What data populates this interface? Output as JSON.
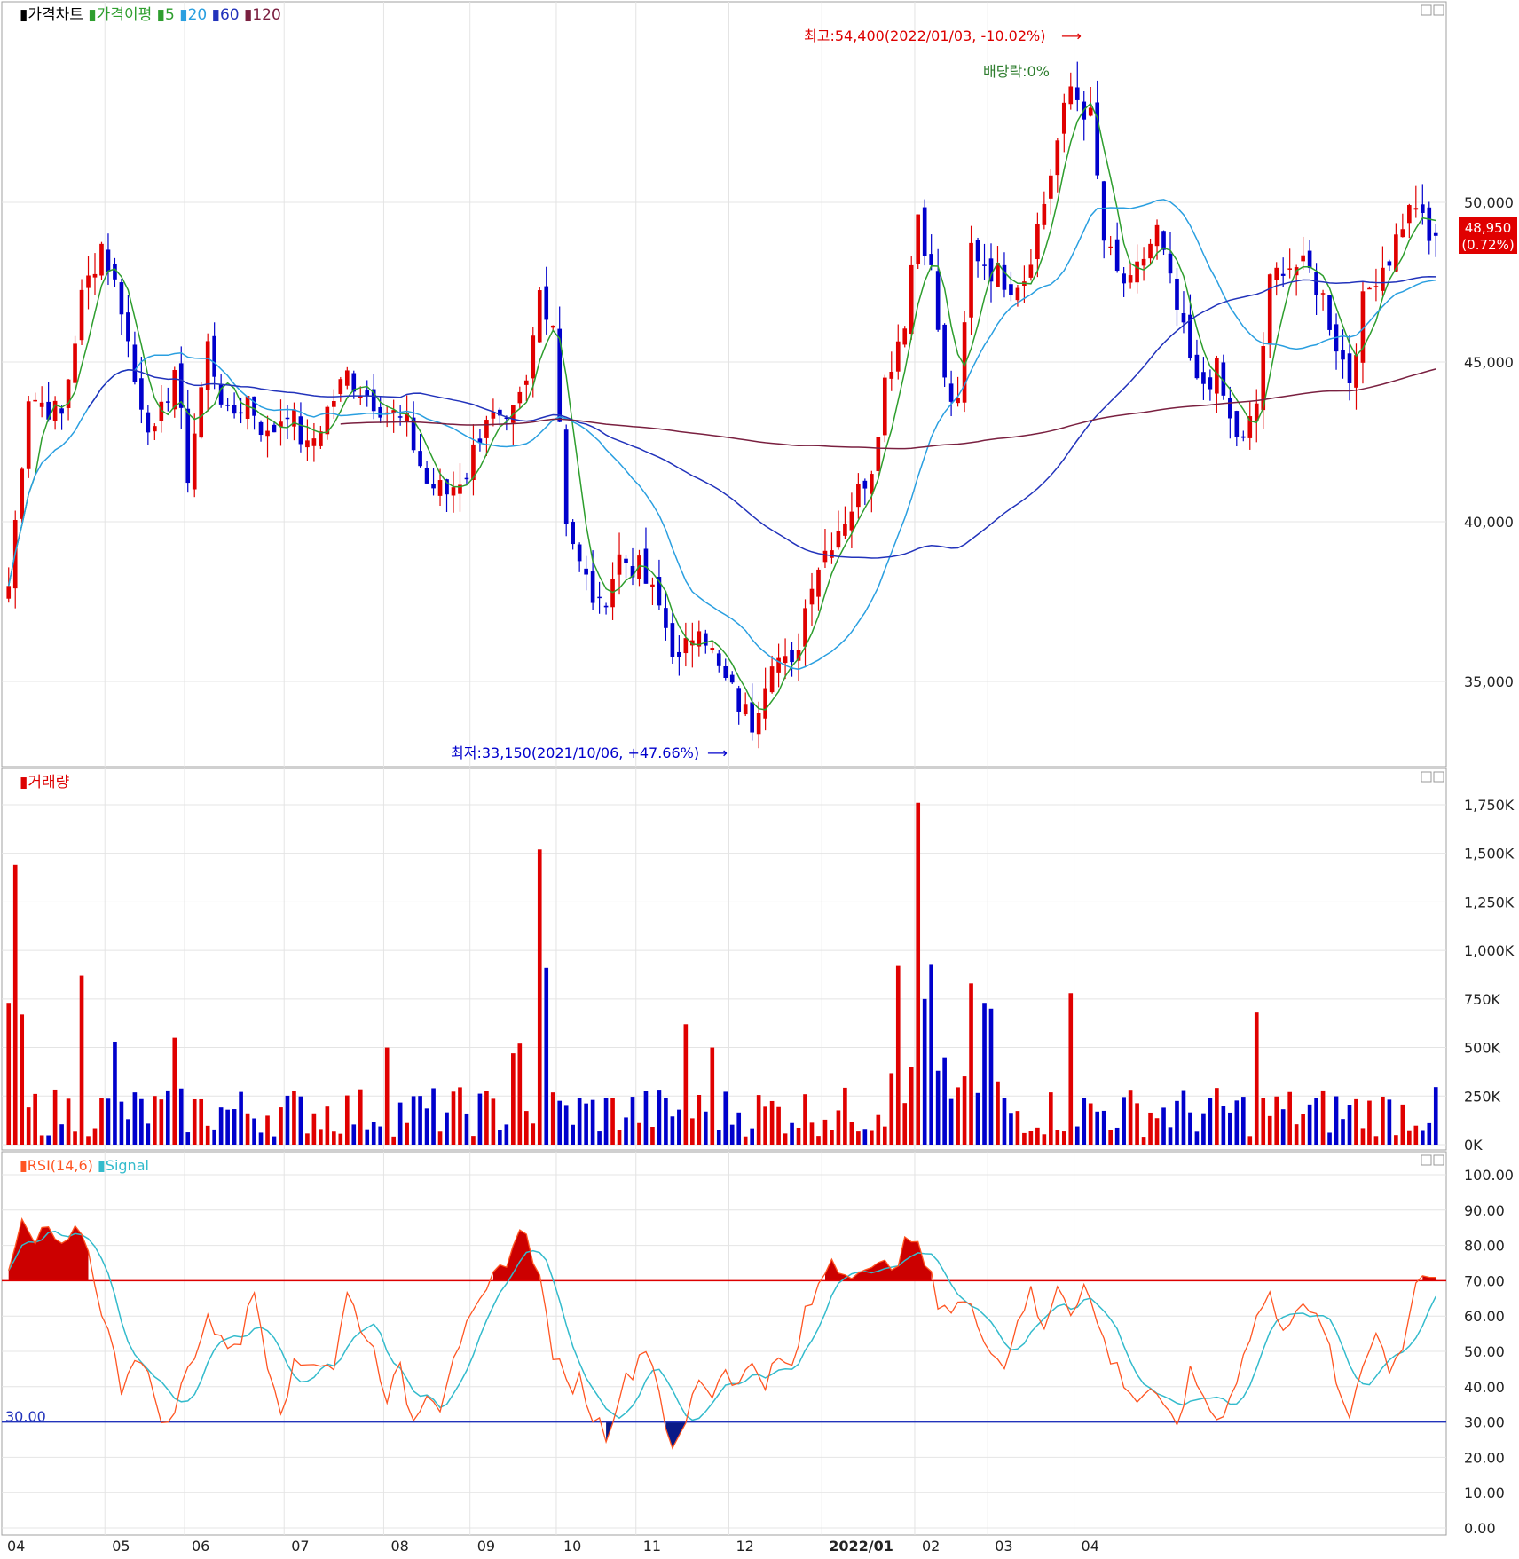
{
  "legends": {
    "price": [
      {
        "text": "가격차트",
        "color": "#000000"
      },
      {
        "text": "가격이평",
        "color": "#2e9e2e"
      },
      {
        "text": "5",
        "color": "#2e9e2e"
      },
      {
        "text": "20",
        "color": "#2a9fe0"
      },
      {
        "text": "60",
        "color": "#2233bb"
      },
      {
        "text": "120",
        "color": "#7a2040"
      }
    ],
    "volume": [
      {
        "text": "거래량",
        "color": "#dd0000"
      }
    ],
    "rsi": [
      {
        "text": "RSI(14,6)",
        "color": "#ff5522"
      },
      {
        "text": "Signal",
        "color": "#33bbcc"
      }
    ]
  },
  "annotations": {
    "high": "최고:54,400(2022/01/03, -10.02%)",
    "low": "최저:33,150(2021/10/06, +47.66%)",
    "dividend": "배당락:0%"
  },
  "current_price": {
    "price": "48,950",
    "change": "(0.72%)"
  },
  "rsi_level_label": "30.00",
  "x_ticks": [
    "04",
    "05",
    "06",
    "07",
    "08",
    "09",
    "10",
    "11",
    "12",
    "2022/01",
    "02",
    "03",
    "04"
  ],
  "price_ticks": [
    "50,000",
    "45,000",
    "40,000",
    "35,000"
  ],
  "volume_ticks": [
    "1,750K",
    "1,500K",
    "1,250K",
    "1,000K",
    "750K",
    "500K",
    "250K",
    "0K"
  ],
  "rsi_ticks": [
    "100.00",
    "90.00",
    "80.00",
    "70.00",
    "60.00",
    "50.00",
    "40.00",
    "30.00",
    "20.00",
    "10.00",
    "0.00"
  ],
  "colors": {
    "up": "#e00000",
    "down": "#0000cc",
    "ma5": "#2e9e2e",
    "ma20": "#2a9fe0",
    "ma60": "#2233bb",
    "ma120": "#7a2040",
    "rsi": "#ff5522",
    "signal": "#33bbcc",
    "grid": "#e4e4e4"
  },
  "chart_data": [
    {
      "type": "candlestick",
      "title": "가격차트",
      "x_months": [
        "04",
        "05",
        "06",
        "07",
        "08",
        "09",
        "10",
        "11",
        "12",
        "2022/01",
        "02",
        "03",
        "04"
      ],
      "ylim": [
        32500,
        55500
      ],
      "high": {
        "value": 54400,
        "date": "2022/01/03"
      },
      "low": {
        "value": 33150,
        "date": "2021/10/06"
      },
      "last": 48950,
      "anchors": [
        [
          0,
          38000
        ],
        [
          3,
          44000
        ],
        [
          8,
          43300
        ],
        [
          11,
          47000
        ],
        [
          14,
          48700
        ],
        [
          17,
          46800
        ],
        [
          19,
          44400
        ],
        [
          22,
          42600
        ],
        [
          25,
          44800
        ],
        [
          27,
          41500
        ],
        [
          30,
          45500
        ],
        [
          33,
          43200
        ],
        [
          36,
          43900
        ],
        [
          39,
          42600
        ],
        [
          42,
          43600
        ],
        [
          45,
          42200
        ],
        [
          48,
          43500
        ],
        [
          51,
          44600
        ],
        [
          54,
          44000
        ],
        [
          57,
          43500
        ],
        [
          60,
          43000
        ],
        [
          63,
          41200
        ],
        [
          66,
          40900
        ],
        [
          69,
          41600
        ],
        [
          72,
          43400
        ],
        [
          75,
          42800
        ],
        [
          78,
          44200
        ],
        [
          80,
          47200
        ],
        [
          82,
          46300
        ],
        [
          84,
          40200
        ],
        [
          86,
          38600
        ],
        [
          89,
          37200
        ],
        [
          92,
          38900
        ],
        [
          95,
          38500
        ],
        [
          98,
          37300
        ],
        [
          101,
          35500
        ],
        [
          104,
          37000
        ],
        [
          107,
          35300
        ],
        [
          110,
          34300
        ],
        [
          112,
          33700
        ],
        [
          115,
          35900
        ],
        [
          118,
          35300
        ],
        [
          121,
          38300
        ],
        [
          124,
          39500
        ],
        [
          127,
          40500
        ],
        [
          130,
          41800
        ],
        [
          132,
          44400
        ],
        [
          135,
          46400
        ],
        [
          137,
          49700
        ],
        [
          139,
          47800
        ],
        [
          141,
          44300
        ],
        [
          143,
          43500
        ],
        [
          145,
          48600
        ],
        [
          148,
          47900
        ],
        [
          151,
          47500
        ],
        [
          153,
          47700
        ],
        [
          156,
          50000
        ],
        [
          158,
          51900
        ],
        [
          160,
          53600
        ],
        [
          163,
          52600
        ],
        [
          165,
          48800
        ],
        [
          167,
          47700
        ],
        [
          169,
          47300
        ],
        [
          171,
          48300
        ],
        [
          173,
          49100
        ],
        [
          175,
          47400
        ],
        [
          177,
          45800
        ],
        [
          179,
          44200
        ],
        [
          182,
          44700
        ],
        [
          184,
          43100
        ],
        [
          186,
          42400
        ],
        [
          188,
          43700
        ],
        [
          190,
          47400
        ],
        [
          192,
          48100
        ],
        [
          194,
          48000
        ],
        [
          196,
          47800
        ],
        [
          198,
          47000
        ],
        [
          200,
          45600
        ],
        [
          202,
          44500
        ],
        [
          204,
          46800
        ],
        [
          206,
          47800
        ],
        [
          208,
          48300
        ],
        [
          210,
          49400
        ],
        [
          212,
          50000
        ],
        [
          213,
          49300
        ],
        [
          214,
          48700
        ],
        [
          215,
          48950
        ]
      ],
      "ma": [
        {
          "name": "5",
          "period": 5
        },
        {
          "name": "20",
          "period": 20
        },
        {
          "name": "60",
          "period": 60
        },
        {
          "name": "120",
          "period": 120
        }
      ]
    },
    {
      "type": "bar",
      "title": "거래량",
      "ylim": [
        0,
        1800
      ],
      "unit": "K",
      "spikes": [
        [
          1,
          1440
        ],
        [
          0,
          730
        ],
        [
          2,
          670
        ],
        [
          11,
          870
        ],
        [
          80,
          1520
        ],
        [
          81,
          910
        ],
        [
          137,
          1760
        ],
        [
          139,
          930
        ],
        [
          138,
          750
        ],
        [
          134,
          920
        ],
        [
          145,
          830
        ],
        [
          147,
          730
        ],
        [
          148,
          700
        ],
        [
          160,
          780
        ],
        [
          188,
          680
        ],
        [
          102,
          620
        ],
        [
          106,
          500
        ],
        [
          57,
          500
        ],
        [
          77,
          520
        ],
        [
          76,
          470
        ],
        [
          16,
          530
        ],
        [
          25,
          550
        ]
      ]
    },
    {
      "type": "line",
      "title": "RSI(14,6)",
      "ylim": [
        0,
        100
      ],
      "levels": [
        30,
        70
      ],
      "series": [
        {
          "name": "RSI(14,6)"
        },
        {
          "name": "Signal"
        }
      ],
      "anchors": [
        [
          0,
          72
        ],
        [
          2,
          86
        ],
        [
          4,
          80
        ],
        [
          6,
          85
        ],
        [
          8,
          78
        ],
        [
          11,
          85
        ],
        [
          13,
          70
        ],
        [
          15,
          55
        ],
        [
          17,
          40
        ],
        [
          19,
          50
        ],
        [
          21,
          42
        ],
        [
          24,
          28
        ],
        [
          27,
          45
        ],
        [
          30,
          60
        ],
        [
          32,
          52
        ],
        [
          35,
          54
        ],
        [
          37,
          67
        ],
        [
          39,
          48
        ],
        [
          41,
          35
        ],
        [
          43,
          45
        ],
        [
          46,
          48
        ],
        [
          49,
          46
        ],
        [
          51,
          66
        ],
        [
          53,
          58
        ],
        [
          55,
          50
        ],
        [
          57,
          38
        ],
        [
          59,
          44
        ],
        [
          61,
          30
        ],
        [
          63,
          40
        ],
        [
          65,
          35
        ],
        [
          67,
          50
        ],
        [
          69,
          56
        ],
        [
          71,
          62
        ],
        [
          73,
          70
        ],
        [
          76,
          80
        ],
        [
          78,
          85
        ],
        [
          80,
          70
        ],
        [
          82,
          50
        ],
        [
          84,
          40
        ],
        [
          86,
          42
        ],
        [
          88,
          32
        ],
        [
          90,
          27
        ],
        [
          92,
          38
        ],
        [
          94,
          45
        ],
        [
          96,
          52
        ],
        [
          98,
          40
        ],
        [
          100,
          20
        ],
        [
          102,
          30
        ],
        [
          104,
          43
        ],
        [
          106,
          38
        ],
        [
          108,
          46
        ],
        [
          110,
          40
        ],
        [
          112,
          47
        ],
        [
          114,
          42
        ],
        [
          116,
          47
        ],
        [
          118,
          45
        ],
        [
          120,
          60
        ],
        [
          122,
          68
        ],
        [
          124,
          77
        ],
        [
          126,
          72
        ],
        [
          128,
          75
        ],
        [
          130,
          72
        ],
        [
          132,
          74
        ],
        [
          134,
          77
        ],
        [
          136,
          82
        ],
        [
          138,
          75
        ],
        [
          140,
          65
        ],
        [
          142,
          62
        ],
        [
          144,
          64
        ],
        [
          146,
          58
        ],
        [
          148,
          52
        ],
        [
          150,
          45
        ],
        [
          152,
          60
        ],
        [
          154,
          66
        ],
        [
          156,
          55
        ],
        [
          158,
          70
        ],
        [
          160,
          62
        ],
        [
          162,
          69
        ],
        [
          164,
          58
        ],
        [
          166,
          48
        ],
        [
          168,
          42
        ],
        [
          170,
          36
        ],
        [
          172,
          40
        ],
        [
          174,
          32
        ],
        [
          176,
          30
        ],
        [
          178,
          43
        ],
        [
          180,
          38
        ],
        [
          182,
          30
        ],
        [
          184,
          38
        ],
        [
          186,
          48
        ],
        [
          188,
          60
        ],
        [
          190,
          65
        ],
        [
          192,
          58
        ],
        [
          194,
          62
        ],
        [
          196,
          60
        ],
        [
          198,
          58
        ],
        [
          200,
          40
        ],
        [
          202,
          32
        ],
        [
          204,
          48
        ],
        [
          206,
          55
        ],
        [
          208,
          46
        ],
        [
          210,
          52
        ],
        [
          212,
          70
        ],
        [
          214,
          72
        ],
        [
          215,
          68
        ]
      ]
    }
  ]
}
